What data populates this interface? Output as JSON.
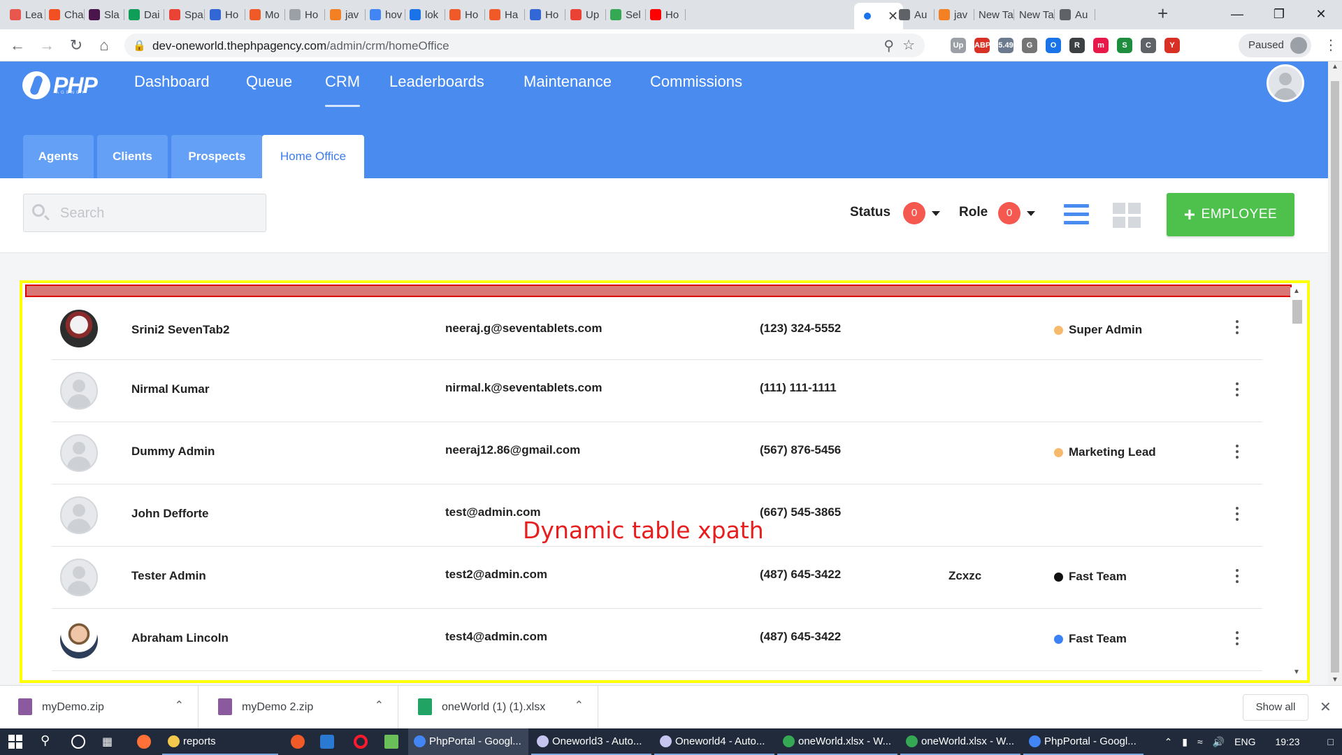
{
  "browser": {
    "tabs": [
      {
        "title": "Lea",
        "color": "#e8574d"
      },
      {
        "title": "Cha",
        "color": "#f25022"
      },
      {
        "title": "Sla",
        "color": "#4a154b"
      },
      {
        "title": "Dai",
        "color": "#0f9d58"
      },
      {
        "title": "Spa",
        "color": "#ea4335"
      },
      {
        "title": "Ho",
        "color": "#3367d6"
      },
      {
        "title": "Mo",
        "color": "#f05a28"
      },
      {
        "title": "Ho",
        "color": "#9aa0a6"
      },
      {
        "title": "jav",
        "color": "#f48024"
      },
      {
        "title": "hov",
        "color": "#4285f4"
      },
      {
        "title": "lok",
        "color": "#1a73e8"
      },
      {
        "title": "Ho",
        "color": "#f05a28"
      },
      {
        "title": "Ha",
        "color": "#f05a28"
      },
      {
        "title": "Ho",
        "color": "#3367d6"
      },
      {
        "title": "Up",
        "color": "#ea4335"
      },
      {
        "title": "Sel",
        "color": "#34a853"
      },
      {
        "title": "Ho",
        "color": "#ff0000"
      },
      {
        "title": "",
        "color": "#1a73e8"
      },
      {
        "title": "Au",
        "color": "#5f6368"
      },
      {
        "title": "jav",
        "color": "#f48024"
      },
      {
        "title": "New Ta",
        "color": ""
      },
      {
        "title": "New Ta",
        "color": ""
      },
      {
        "title": "Au",
        "color": "#5f6368"
      }
    ],
    "url_host": "dev-oneworld.thephpagency.com",
    "url_path": "/admin/crm/homeOffice",
    "extensions": [
      {
        "label": "Up",
        "color": "#9aa0a6"
      },
      {
        "label": "ABP",
        "color": "#d93025"
      },
      {
        "label": "5.49",
        "color": "#6b7a8f"
      },
      {
        "label": "G",
        "color": "#757575"
      },
      {
        "label": "O",
        "color": "#1a73e8"
      },
      {
        "label": "R",
        "color": "#3c4043"
      },
      {
        "label": "m",
        "color": "#e8194a"
      },
      {
        "label": "S",
        "color": "#1e8e3e"
      },
      {
        "label": "C",
        "color": "#5f6368"
      },
      {
        "label": "Y",
        "color": "#d93025"
      }
    ],
    "profile_label": "Paused"
  },
  "app": {
    "logo": "PHP",
    "logo_sub": "AGENCY",
    "nav": [
      {
        "label": "Dashboard",
        "active": false
      },
      {
        "label": "Queue",
        "active": false
      },
      {
        "label": "CRM",
        "active": true
      },
      {
        "label": "Leaderboards",
        "active": false
      },
      {
        "label": "Maintenance",
        "active": false
      },
      {
        "label": "Commissions",
        "active": false
      }
    ],
    "subtabs": [
      {
        "label": "Agents",
        "active": false
      },
      {
        "label": "Clients",
        "active": false
      },
      {
        "label": "Prospects",
        "active": false
      },
      {
        "label": "Home Office",
        "active": true
      }
    ],
    "search_placeholder": "Search",
    "filters": {
      "status_label": "Status",
      "status_count": "0",
      "role_label": "Role",
      "role_count": "0"
    },
    "add_button_label": "EMPLOYEE",
    "annotation": "Dynamic table xpath",
    "employees": [
      {
        "name": "Srini2 SevenTab2",
        "email": "neeraj.g@seventablets.com",
        "phone": "(123) 324-5552",
        "team": "",
        "role": "Super Admin",
        "role_color": "#f7b96b",
        "avatar": "anime"
      },
      {
        "name": "Nirmal Kumar",
        "email": "nirmal.k@seventablets.com",
        "phone": "(111) 111-1111",
        "team": "",
        "role": "",
        "role_color": "",
        "avatar": "placeholder"
      },
      {
        "name": "Dummy Admin",
        "email": "neeraj12.86@gmail.com",
        "phone": "(567) 876-5456",
        "team": "",
        "role": "Marketing Lead",
        "role_color": "#f7b96b",
        "avatar": "placeholder"
      },
      {
        "name": "John Defforte",
        "email": "test@admin.com",
        "phone": "(667) 545-3865",
        "team": "",
        "role": "",
        "role_color": "",
        "avatar": "placeholder"
      },
      {
        "name": "Tester Admin",
        "email": "test2@admin.com",
        "phone": "(487) 645-3422",
        "team": "Zcxzc",
        "role": "Fast Team",
        "role_color": "#111111",
        "avatar": "placeholder"
      },
      {
        "name": "Abraham Lincoln",
        "email": "test4@admin.com",
        "phone": "(487) 645-3422",
        "team": "",
        "role": "Fast Team",
        "role_color": "#3b82f6",
        "avatar": "photo"
      }
    ]
  },
  "downloads": {
    "items": [
      {
        "name": "myDemo.zip",
        "color": "#8b5a9e"
      },
      {
        "name": "myDemo 2.zip",
        "color": "#8b5a9e"
      },
      {
        "name": "oneWorld (1) (1).xlsx",
        "color": "#21a366"
      }
    ],
    "show_all_label": "Show all"
  },
  "taskbar": {
    "items": [
      {
        "label": "reports",
        "color": "#f2c94c",
        "style": "open"
      },
      {
        "label": "PhpPortal - Googl...",
        "color": "#4285f4",
        "style": "app"
      },
      {
        "label": "Oneworld3 - Auto...",
        "color": "#c5c5f0",
        "style": "open"
      },
      {
        "label": "Oneworld4 - Auto...",
        "color": "#c5c5f0",
        "style": "open"
      },
      {
        "label": "oneWorld.xlsx - W...",
        "color": "#34a853",
        "style": "open"
      },
      {
        "label": "oneWorld.xlsx - W...",
        "color": "#34a853",
        "style": "open"
      },
      {
        "label": "PhpPortal - Googl...",
        "color": "#4285f4",
        "style": "open"
      }
    ],
    "language": "ENG",
    "time": "19:23"
  }
}
